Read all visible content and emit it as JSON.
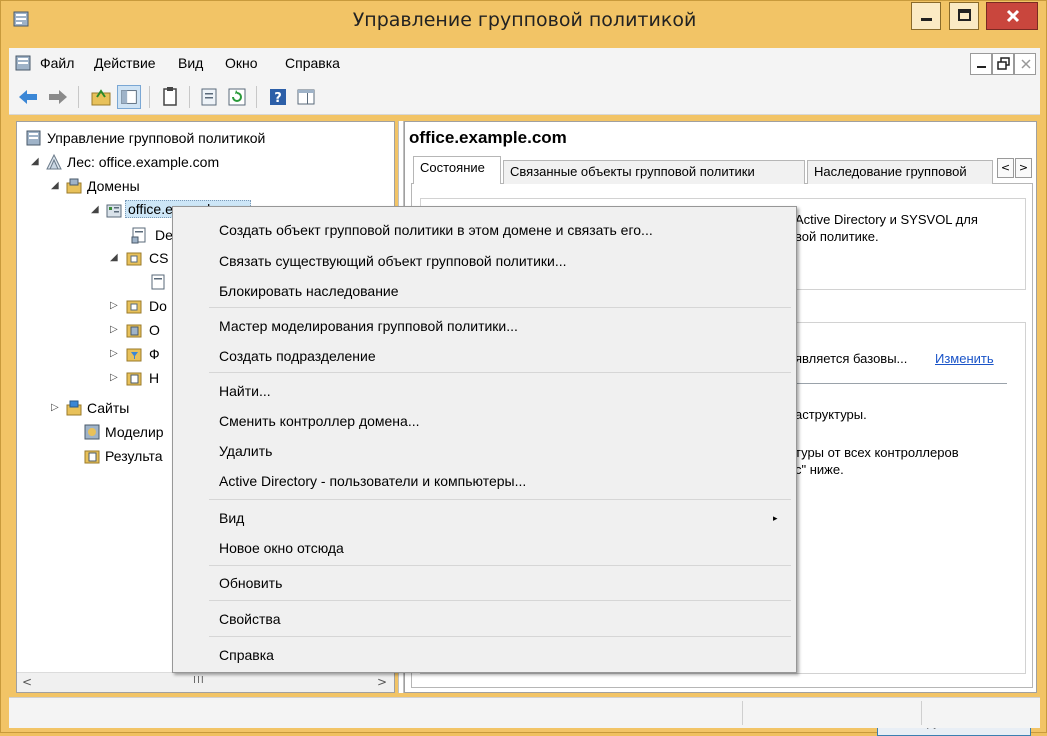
{
  "window": {
    "title": "Управление групповой политикой",
    "colors": {
      "frame": "#f2c466",
      "close_button": "#c9463d"
    }
  },
  "menubar": {
    "items": [
      "Файл",
      "Действие",
      "Вид",
      "Окно",
      "Справка"
    ]
  },
  "toolbar": {
    "buttons": [
      "back-icon",
      "forward-icon",
      "up-folder-icon",
      "show-hide-tree-icon",
      "clipboard-icon",
      "properties-icon",
      "refresh-icon",
      "help-icon",
      "console-view-icon"
    ]
  },
  "tree": {
    "root": "Управление групповой политикой",
    "forest": "Лес: office.example.com",
    "domains": "Домены",
    "domain": "office.example.com",
    "partial": {
      "default_domain_policy": "De",
      "cs_ou": "CS",
      "dc_ou": "Do",
      "o_item": "O",
      "f_item": "Ф",
      "n_item": "H"
    },
    "sites": "Сайты",
    "modeling": "Моделир",
    "results": "Результа",
    "scroll_grip": "III"
  },
  "right": {
    "heading": "office.example.com",
    "tabs": [
      "Состояние",
      "Связанные объекты групповой политики",
      "Наследование групповой"
    ],
    "tab_scroll": [
      "<",
      ">"
    ],
    "box1_line1": "Active Directory и SYSVOL для",
    "box1_line2": "вой политике.",
    "box2_line1": "является базовы...",
    "box2_link": "Изменить",
    "box2_line2": "аструктуры.",
    "box2_line3": "туры от всех контроллеров",
    "box2_line4": "с\" ниже.",
    "detect_button": "Обнаружить сейчас"
  },
  "context_menu": {
    "items": [
      "Создать объект групповой политики в этом домене и связать его...",
      "Связать существующий объект групповой политики...",
      "Блокировать наследование",
      "Мастер моделирования групповой политики...",
      "Создать подразделение",
      "Найти...",
      "Сменить контроллер домена...",
      "Удалить",
      "Active Directory - пользователи и компьютеры...",
      "Вид",
      "Новое окно отсюда",
      "Обновить",
      "Свойства",
      "Справка"
    ],
    "submenu_arrow": "▸"
  }
}
